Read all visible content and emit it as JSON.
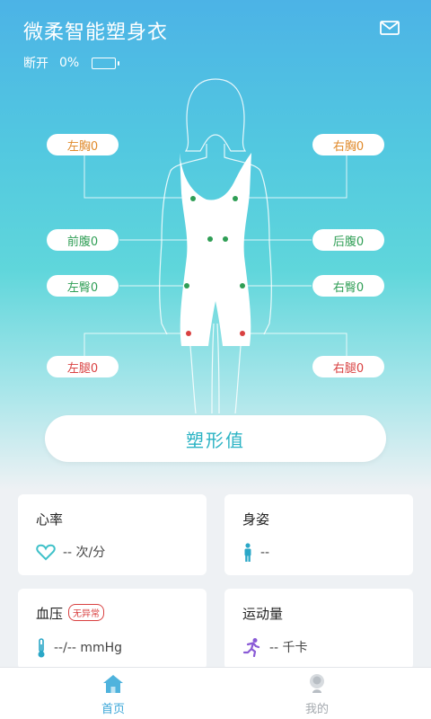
{
  "header": {
    "title": "微柔智能塑身衣",
    "connection_status": "断开",
    "battery_percent": "0%"
  },
  "colors": {
    "accent": "#2bb3c4",
    "orange": "#e08a2b",
    "green": "#2f9e55",
    "red": "#d94141"
  },
  "sensors": {
    "left_chest": "左胸0",
    "right_chest": "右胸0",
    "front_abdomen": "前腹0",
    "back_abdomen": "后腹0",
    "left_hip": "左臀0",
    "right_hip": "右臀0",
    "left_thigh": "左腿0",
    "right_thigh": "右腿0"
  },
  "shape_button": "塑形值",
  "cards": {
    "heart_rate": {
      "title": "心率",
      "value": "-- 次/分"
    },
    "posture": {
      "title": "身姿",
      "value": "--"
    },
    "blood_pressure": {
      "title": "血压",
      "badge": "无异常",
      "value": "--/-- mmHg"
    },
    "exercise": {
      "title": "运动量",
      "value": "-- 千卡"
    }
  },
  "tabbar": {
    "home": "首页",
    "mine": "我的"
  }
}
